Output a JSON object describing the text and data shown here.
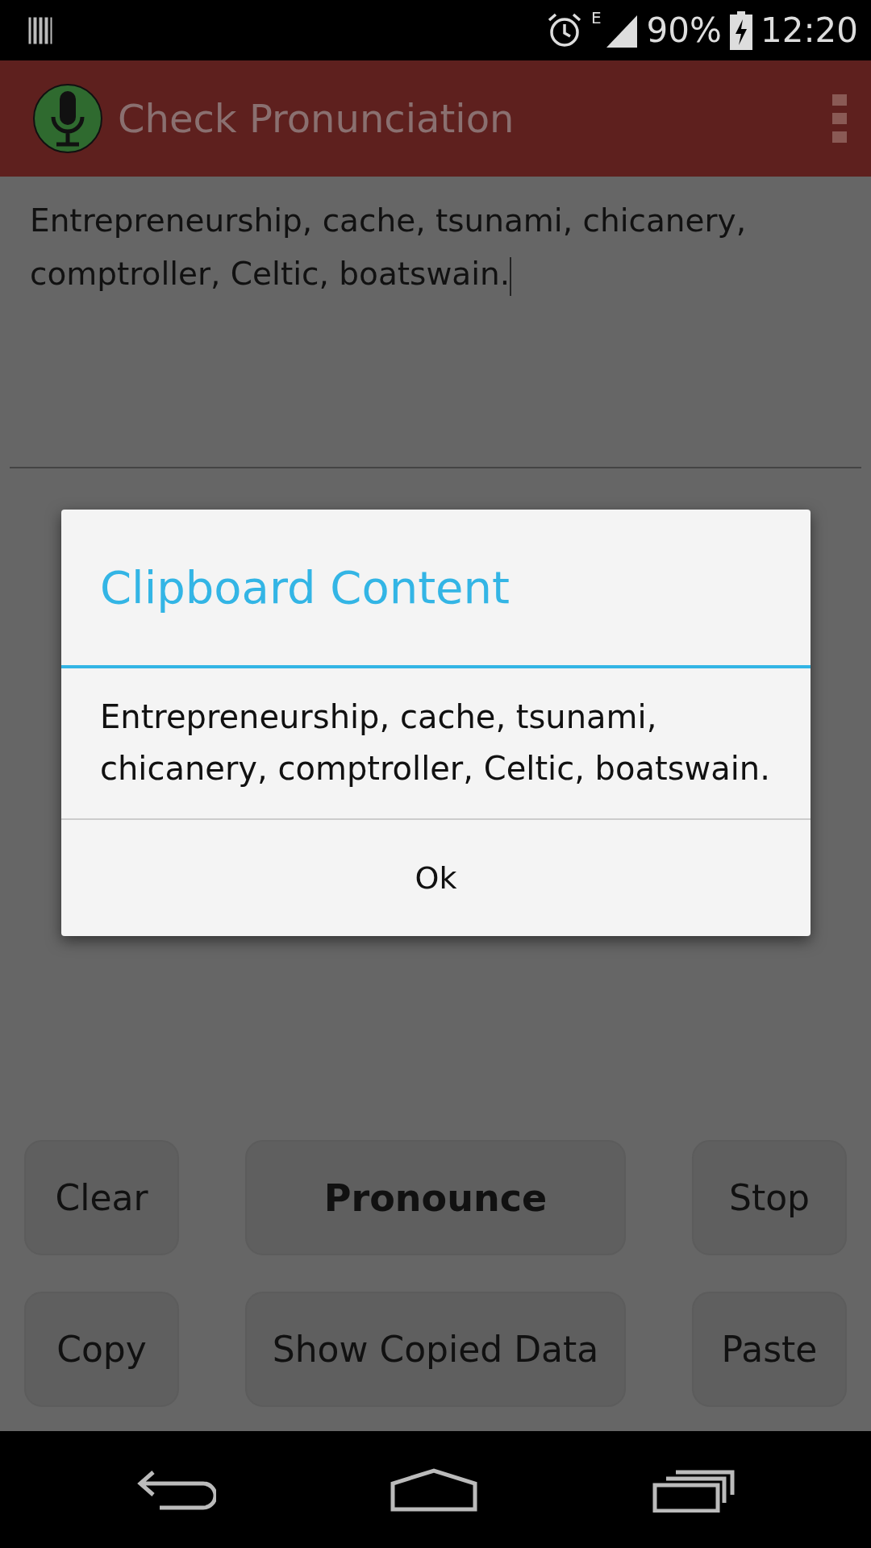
{
  "status_bar": {
    "network_type": "E",
    "battery": "90%",
    "time": "12:20"
  },
  "app_bar": {
    "title": "Check Pronunciation"
  },
  "text_field": {
    "value": "Entrepreneurship, cache, tsunami, chicanery, comptroller, Celtic, boatswain."
  },
  "buttons": [
    {
      "label": "Clear",
      "bold": false
    },
    {
      "label": "Pronounce",
      "bold": true
    },
    {
      "label": "Stop",
      "bold": false
    },
    {
      "label": "Copy",
      "bold": false
    },
    {
      "label": "Show Copied Data",
      "bold": false
    },
    {
      "label": "Paste",
      "bold": false
    }
  ],
  "dialog": {
    "title": "Clipboard Content",
    "message": "Entrepreneurship, cache, tsunami, chicanery, comptroller, Celtic, boatswain.",
    "button": "Ok"
  }
}
